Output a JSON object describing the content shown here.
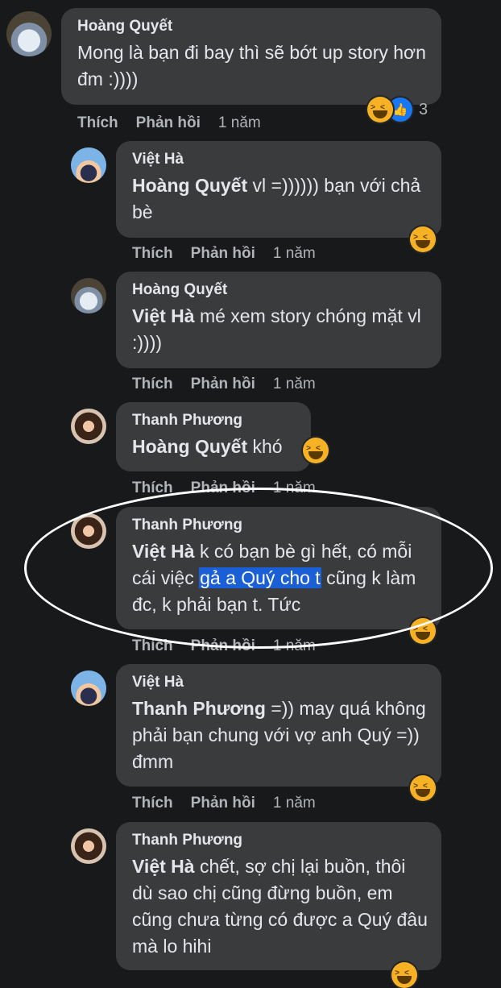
{
  "actions": {
    "like": "Thích",
    "reply": "Phản hồi"
  },
  "comments": [
    {
      "author": "Hoàng Quyết",
      "mention": "",
      "text": "Mong là bạn đi bay thì sẽ bớt up story hơn đm :))))",
      "time": "1 năm",
      "reaction_count": "3"
    },
    {
      "author": "Việt Hà",
      "mention": "Hoàng Quyết",
      "text": " vl =)))))) bạn với chả bè",
      "time": "1 năm"
    },
    {
      "author": "Hoàng Quyết",
      "mention": "Việt Hà",
      "text": " mé xem story chóng mặt vl :))))",
      "time": "1 năm"
    },
    {
      "author": "Thanh Phương",
      "mention": "Hoàng Quyết",
      "text": " khó",
      "time": "1 năm"
    },
    {
      "author": "Thanh Phương",
      "mention": "Việt Hà",
      "text_before": " k có bạn bè gì hết, có mỗi cái việc ",
      "highlight": "gả a Quý cho t",
      "text_after": " cũng k làm đc, k phải bạn t. Tức",
      "time": "1 năm"
    },
    {
      "author": "Việt Hà",
      "mention": "Thanh Phương",
      "text": " =)) may quá không phải bạn chung với vợ anh Quý =)) đmm",
      "time": "1 năm"
    },
    {
      "author": "Thanh Phương",
      "mention": "Việt Hà",
      "text": " chết, sợ chị lại buồn, thôi dù sao chị cũng đừng buồn, em cũng chưa từng có được a Quý đâu mà lo hihi"
    }
  ]
}
